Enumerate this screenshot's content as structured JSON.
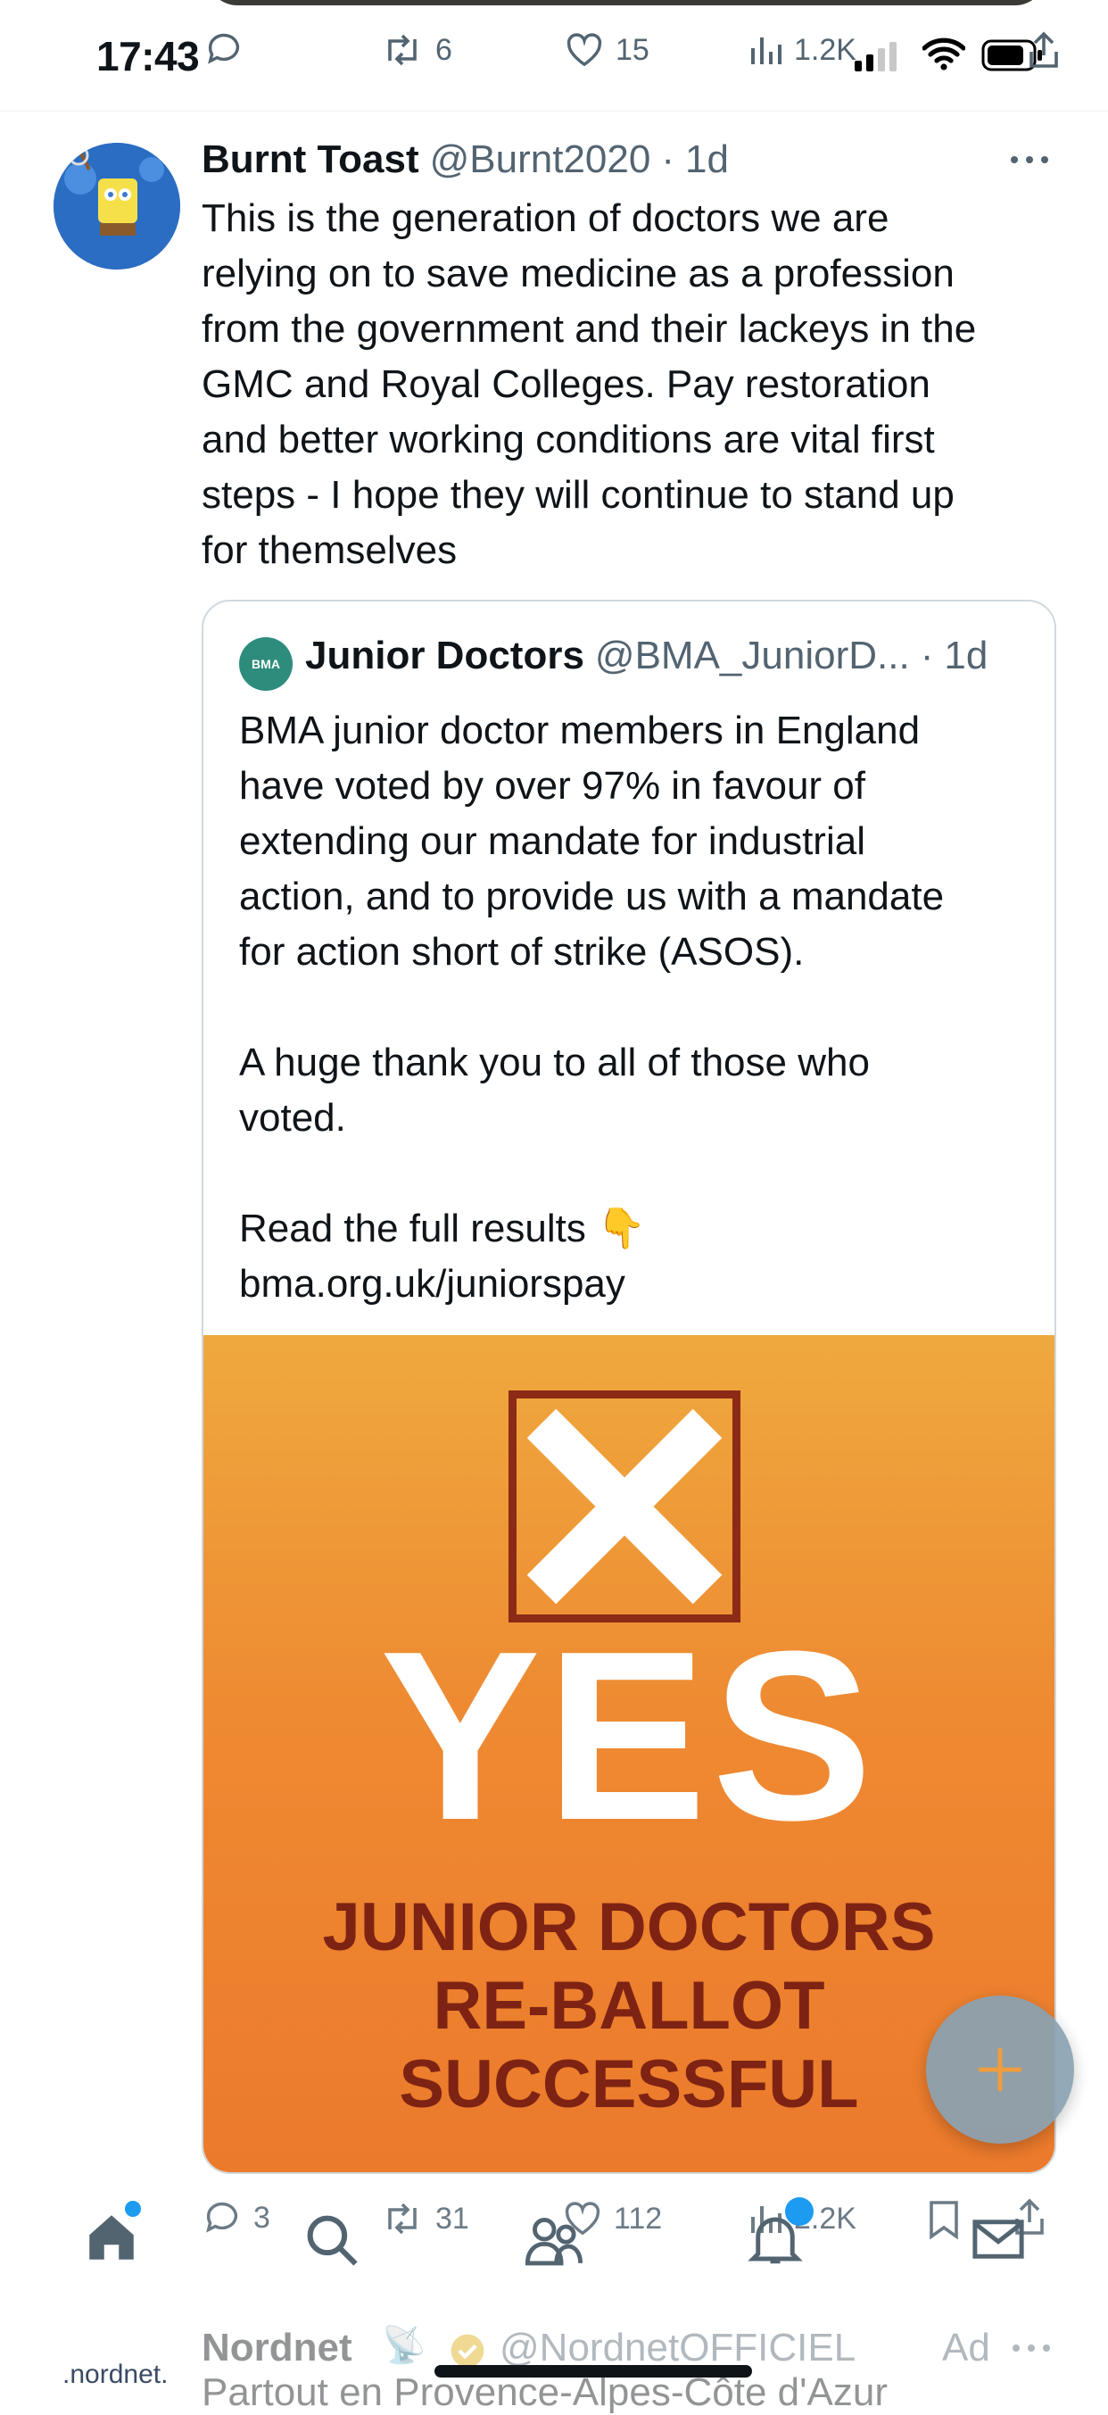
{
  "status_bar": {
    "time": "17:43",
    "icons": [
      "signal-bars-icon",
      "wifi-icon",
      "battery-icon"
    ]
  },
  "top_actions": {
    "retweets": "6",
    "likes": "15",
    "views": "1.2K",
    "icons": [
      "reply-icon",
      "retweet-icon",
      "like-icon",
      "views-icon",
      "share-icon"
    ]
  },
  "tweet": {
    "author_name": "Burnt Toast",
    "handle": "@Burnt2020",
    "dot": "·",
    "time": "1d",
    "text_lines": [
      "This is the generation of doctors we are",
      "relying on to save medicine as a profession",
      "from the government and their lackeys in the",
      "GMC and Royal Colleges. Pay restoration",
      "and better working conditions are vital first",
      "steps - I hope they will continue to stand up",
      "for themselves"
    ],
    "quote": {
      "author_name": "Junior Doctors",
      "handle": "@BMA_JuniorD...",
      "dot": "·",
      "time": "1d",
      "avatar_text": "BMA",
      "text": "BMA junior doctor members in England\nhave voted by over 97% in favour of\nextending our mandate for industrial\naction, and to provide us with a mandate\nfor action short of strike (ASOS).\n\nA huge thank you to all of those who\nvoted.\n\nRead the full results 👇\nbma.org.uk/juniorspay",
      "image": {
        "big_word": "YES",
        "headline_lines": [
          "JUNIOR DOCTORS",
          "RE-BALLOT",
          "SUCCESSFUL"
        ]
      }
    },
    "engagement": {
      "replies": "3",
      "retweets": "31",
      "likes": "112",
      "views": "2.2K"
    }
  },
  "fab": {
    "label": "+"
  },
  "tab_bar": {
    "tabs": [
      "home-icon",
      "search-icon",
      "communities-icon",
      "notifications-icon",
      "messages-icon"
    ],
    "notification_dot": true
  },
  "ad": {
    "logo_text": ".nordnet.",
    "name": "Nordnet",
    "emoji": "📡",
    "handle": "@NordnetOFFICIEL",
    "label": "Ad",
    "text": "Partout en Provence-Alpes-Côte d'Azur"
  },
  "colors": {
    "text": "#0f1419",
    "muted": "#536471",
    "orange": "#ee8a32",
    "dark_red": "#7e2313",
    "fab": "#8aa2b3"
  }
}
